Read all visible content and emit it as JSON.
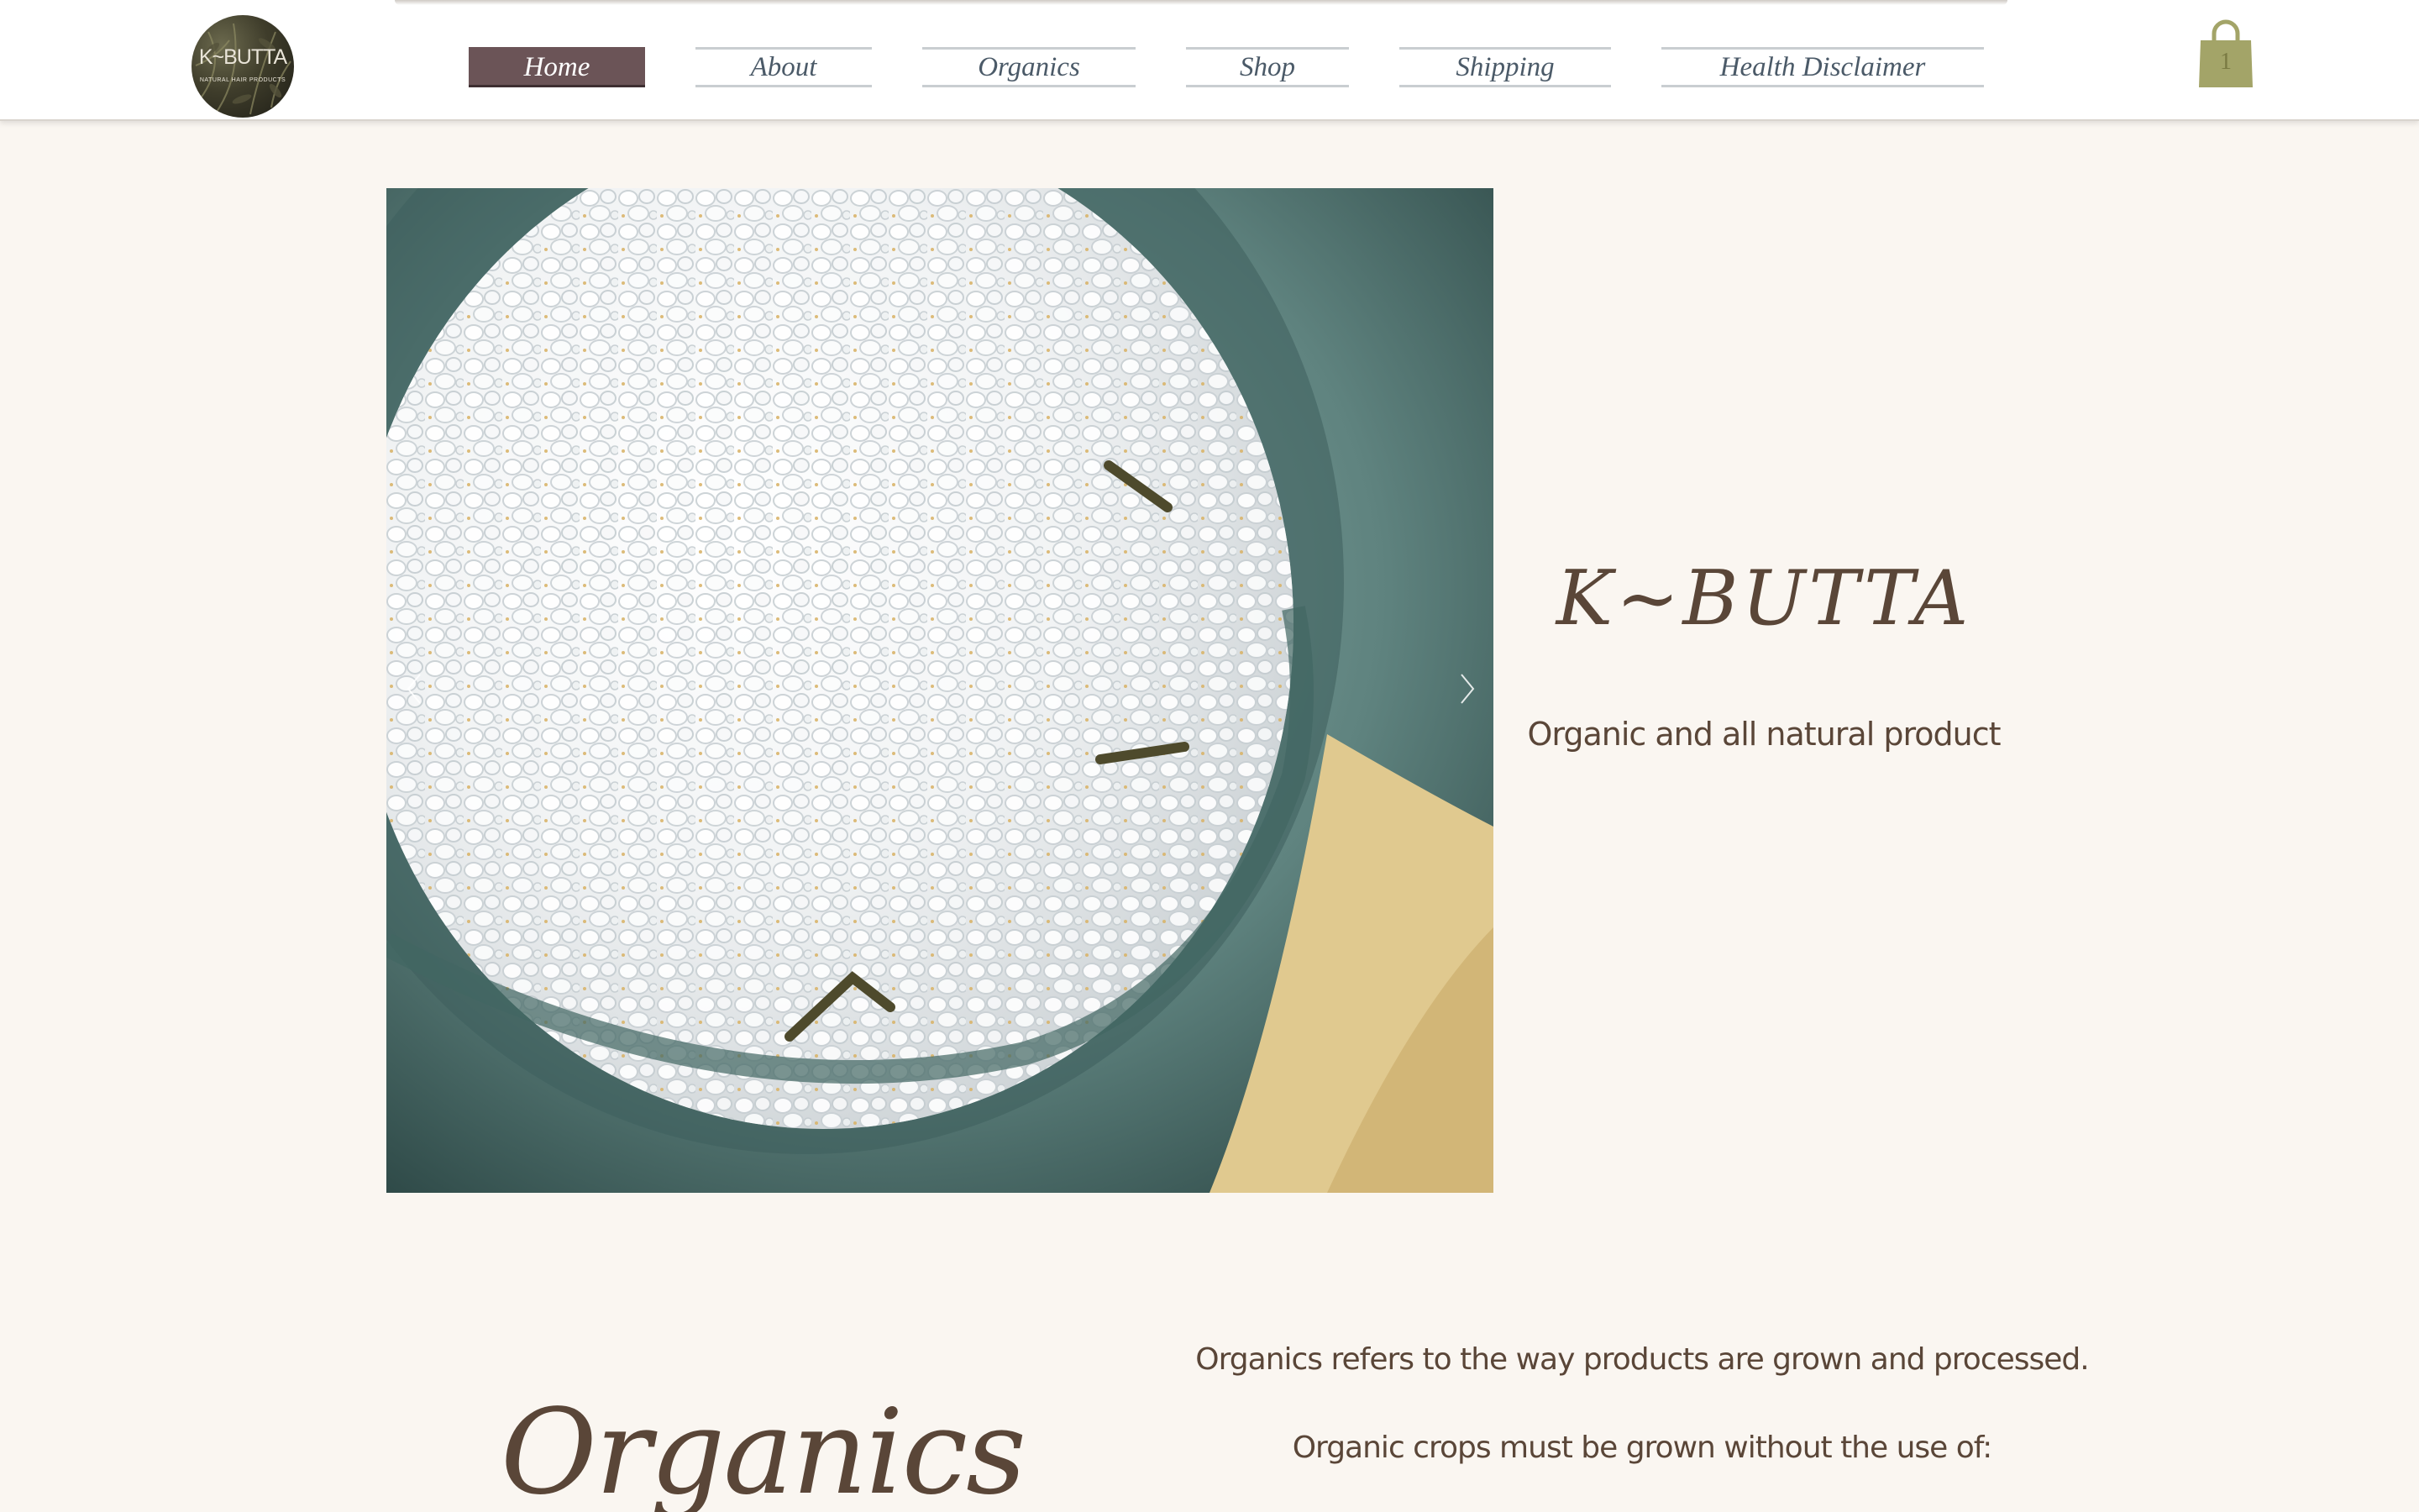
{
  "header": {
    "logo": {
      "name": "K~BUTTA",
      "subtitle": "NATURAL HAIR PRODUCTS"
    },
    "nav": [
      {
        "label": "Home",
        "active": true
      },
      {
        "label": "About",
        "active": false
      },
      {
        "label": "Organics",
        "active": false
      },
      {
        "label": "Shop",
        "active": false
      },
      {
        "label": "Shipping",
        "active": false
      },
      {
        "label": "Health Disclaimer",
        "active": false
      }
    ],
    "cart": {
      "icon": "shopping-bag-icon",
      "count": "1"
    }
  },
  "hero": {
    "image": "bowl-of-sea-salt-with-herbs",
    "prev_icon": "chevron-left-icon",
    "next_icon": "chevron-right-icon",
    "title": "K~BUTTA",
    "tagline": "Organic and all natural product"
  },
  "organics": {
    "heading": "Organics",
    "paragraph_1": "Organics refers to the way  products are grown and processed.",
    "paragraph_2": "Organic crops must be grown without the use of:"
  },
  "colors": {
    "page_background": "#faf6f1",
    "header_background": "#ffffff",
    "nav_active_background": "#6b5457",
    "nav_text": "#4b5a68",
    "body_text": "#5a4638",
    "cart": "#a3a468"
  }
}
